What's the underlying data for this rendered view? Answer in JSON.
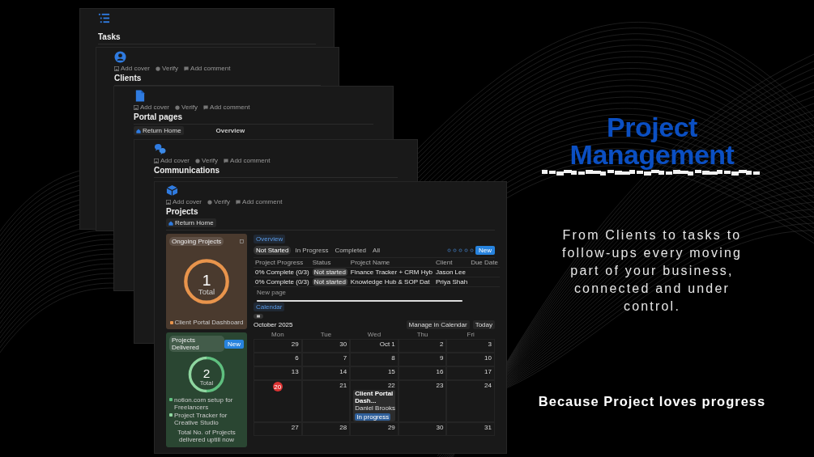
{
  "stack": [
    {
      "title": "Tasks"
    },
    {
      "meta": [
        "Add cover",
        "Verify",
        "Add comment"
      ],
      "title": "Clients"
    },
    {
      "meta": [
        "Add cover",
        "Verify",
        "Add comment"
      ],
      "title": "Portal pages",
      "return_button": "Return Home",
      "section": "Overview"
    },
    {
      "meta": [
        "Add cover",
        "Verify",
        "Add comment"
      ],
      "title": "Communications"
    },
    {
      "meta": [
        "Add cover",
        "Verify",
        "Add comment"
      ],
      "title": "Projects",
      "return_button": "Return Home"
    }
  ],
  "projects_page": {
    "ongoing_card": {
      "tag": "Ongoing Projects",
      "count": "1",
      "count_label": "Total",
      "link": "Client Portal Dashboard"
    },
    "delivered_card": {
      "tag": "Projects Delivered",
      "button": "New",
      "count": "2",
      "count_label": "Total",
      "legend": [
        {
          "label": "notion.com setup for Freelancers",
          "color": "#5fbf7f"
        },
        {
          "label": "Project Tracker for Creative Studio",
          "color": "#8fd6a0"
        }
      ],
      "caption": "Total No. of Projects delivered uptill now"
    },
    "overview": {
      "tab": "Overview",
      "filters": [
        {
          "label": "Not Started",
          "selected": true
        },
        {
          "label": "In Progress",
          "selected": false
        },
        {
          "label": "Completed",
          "selected": false
        },
        {
          "label": "All",
          "selected": false
        }
      ],
      "button": "New",
      "columns": [
        "Project Progress",
        "Status",
        "Project Name",
        "Client",
        "Due Date"
      ],
      "rows": [
        {
          "progress": "0% Complete (0/3)",
          "status": "Not started",
          "project": "Finance Tracker + CRM Hyb",
          "client": "Jason Lee"
        },
        {
          "progress": "0% Complete (0/3)",
          "status": "Not started",
          "project": "Knowledge Hub & SOP Dat",
          "client": "Priya Shah"
        }
      ],
      "new_row": "New page"
    },
    "calendar": {
      "tab": "Calendar",
      "month": "October 2025",
      "manage_button": "Manage in Calendar",
      "today_button": "Today",
      "weekdays": [
        "Mon",
        "Tue",
        "Wed",
        "Thu",
        "Fri"
      ],
      "weeks": [
        [
          {
            "day": "29",
            "today": false
          },
          {
            "day": "30",
            "today": false
          },
          {
            "day": "Oct 1",
            "today": false
          },
          {
            "day": "2",
            "today": false
          },
          {
            "day": "3",
            "today": false
          }
        ],
        [
          {
            "day": "6",
            "today": false
          },
          {
            "day": "7",
            "today": false
          },
          {
            "day": "8",
            "today": false
          },
          {
            "day": "9",
            "today": false
          },
          {
            "day": "10",
            "today": false
          }
        ],
        [
          {
            "day": "13",
            "today": false
          },
          {
            "day": "14",
            "today": false
          },
          {
            "day": "15",
            "today": false
          },
          {
            "day": "16",
            "today": false
          },
          {
            "day": "17",
            "today": false
          }
        ],
        [
          {
            "day": "20",
            "today": true
          },
          {
            "day": "21",
            "today": false
          },
          {
            "day": "22",
            "today": false,
            "events": [
              {
                "title": "Client Portal Dash...",
                "person": "Daniel Brooks",
                "status": "In progress"
              }
            ]
          },
          {
            "day": "23",
            "today": false
          },
          {
            "day": "24",
            "today": false
          }
        ],
        [
          {
            "day": "27",
            "today": false
          },
          {
            "day": "28",
            "today": false
          },
          {
            "day": "29",
            "today": false
          },
          {
            "day": "30",
            "today": false
          },
          {
            "day": "31",
            "today": false
          }
        ]
      ]
    }
  },
  "promo": {
    "headline": "Project Management",
    "body": "From Clients to tasks to follow-ups every moving part of your business, connected and under control.",
    "tagline": "Because Project loves progress"
  }
}
